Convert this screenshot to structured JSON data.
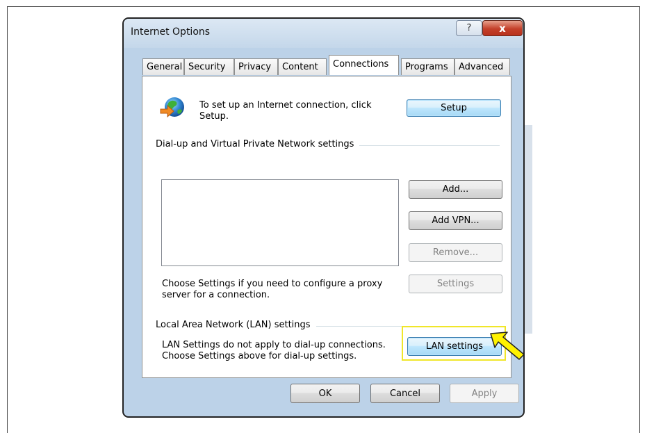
{
  "window": {
    "title": "Internet Options",
    "help_glyph": "?",
    "close_glyph": "x"
  },
  "tabs": [
    {
      "label": "General",
      "active": false
    },
    {
      "label": "Security",
      "active": false
    },
    {
      "label": "Privacy",
      "active": false
    },
    {
      "label": "Content",
      "active": false
    },
    {
      "label": "Connections",
      "active": true
    },
    {
      "label": "Programs",
      "active": false
    },
    {
      "label": "Advanced",
      "active": false
    }
  ],
  "setup": {
    "text": "To set up an Internet connection, click Setup.",
    "button": "Setup"
  },
  "dialup": {
    "group_label": "Dial-up and Virtual Private Network settings",
    "add_button": "Add...",
    "add_vpn_button": "Add VPN...",
    "remove_button": "Remove...",
    "proxy_text": "Choose Settings if you need to configure a proxy server for a connection.",
    "settings_button": "Settings"
  },
  "lan": {
    "group_label": "Local Area Network (LAN) settings",
    "text": "LAN Settings do not apply to dial-up connections. Choose Settings above for dial-up settings.",
    "button": "LAN settings"
  },
  "footer": {
    "ok": "OK",
    "cancel": "Cancel",
    "apply": "Apply"
  },
  "colors": {
    "highlight": "#f0e62a",
    "arrow_fill": "#fff200",
    "close_red": "#c4402a"
  },
  "icons": {
    "connection": "globe-arrow-icon",
    "pointer": "yellow-arrow-icon"
  }
}
